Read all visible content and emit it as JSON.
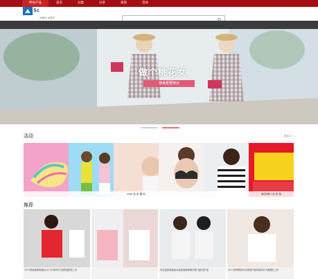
{
  "nav": {
    "items": [
      {
        "label": "所有产品",
        "active": true
      },
      {
        "label": "首页",
        "active": false
      },
      {
        "label": "分类",
        "active": false
      },
      {
        "label": "分享",
        "active": false
      },
      {
        "label": "发现",
        "active": false
      },
      {
        "label": "活动",
        "active": false
      }
    ]
  },
  "header": {
    "logo_text": "Sc",
    "slogan": "优美化 品质化",
    "search_placeholder": "",
    "search_icon": "search-icon"
  },
  "banner": {
    "title": "做个桃花女",
    "subtitle": "穿美更要穿对"
  },
  "sections": {
    "huodong_title": "活动",
    "more_label": "更多>>",
    "tuijian_title": "推荐"
  },
  "huodong_tiles": [
    {
      "caption": ""
    },
    {
      "caption": ""
    },
    {
      "caption": "ntad 全 实 福 利"
    },
    {
      "caption": ""
    },
    {
      "caption": ""
    },
    {
      "caption": "每日6款 1元 秒 抢"
    }
  ],
  "tuijian_cards": [
    {
      "caption": "2013夏装新款韩版女大门字母印花T恤短袖宽松上衣",
      "price": ""
    },
    {
      "caption": "",
      "price": ""
    },
    {
      "caption": "情侣装夏装韩版女装短袖短裤两件套T恤情侣T恤",
      "price": ""
    },
    {
      "caption": "2013夏季新款女式韩版T恤短袖印花卡通宽松上衣",
      "price": ""
    }
  ],
  "colors": {
    "topbar": "#a60d12",
    "active_nav": "#c8231f",
    "dark_band": "#3a3b3e",
    "dot_active": "#e8716c"
  }
}
